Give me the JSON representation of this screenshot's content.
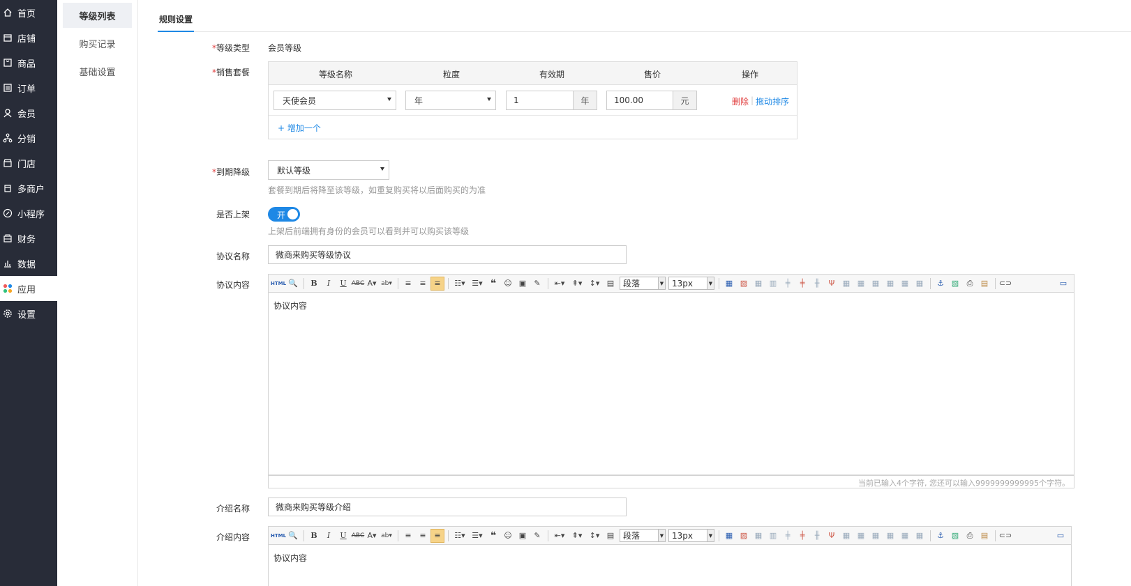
{
  "nav": {
    "items": [
      {
        "label": "首页",
        "icon": "home-icon"
      },
      {
        "label": "店铺",
        "icon": "store-icon"
      },
      {
        "label": "商品",
        "icon": "goods-icon"
      },
      {
        "label": "订单",
        "icon": "order-icon"
      },
      {
        "label": "会员",
        "icon": "user-icon"
      },
      {
        "label": "分销",
        "icon": "distribution-icon"
      },
      {
        "label": "门店",
        "icon": "shop-icon"
      },
      {
        "label": "多商户",
        "icon": "merchant-icon"
      },
      {
        "label": "小程序",
        "icon": "miniprogram-icon"
      },
      {
        "label": "财务",
        "icon": "finance-icon"
      },
      {
        "label": "数据",
        "icon": "chart-icon"
      },
      {
        "label": "应用",
        "icon": "apps-icon"
      },
      {
        "label": "设置",
        "icon": "gear-icon"
      }
    ],
    "active": "应用"
  },
  "subnav": {
    "items": [
      "等级列表",
      "购买记录",
      "基础设置"
    ],
    "active": "等级列表"
  },
  "tab": "规则设置",
  "form": {
    "level_type": {
      "label": "等级类型",
      "value": "会员等级"
    },
    "package": {
      "label": "销售套餐",
      "columns": [
        "等级名称",
        "粒度",
        "有效期",
        "售价",
        "操作"
      ],
      "rows": [
        {
          "level": "天使会员",
          "granularity": "年",
          "validity": "1",
          "validity_unit": "年",
          "price": "100.00",
          "price_unit": "元",
          "delete": "删除",
          "sort": "拖动排序"
        }
      ],
      "add": "+ 增加一个"
    },
    "expire": {
      "label": "到期降级",
      "value": "默认等级",
      "hint": "套餐到期后将降至该等级，如重复购买将以后面购买的为准"
    },
    "shelf": {
      "label": "是否上架",
      "toggle": "开",
      "hint": "上架后前端拥有身份的会员可以看到并可以购买该等级"
    },
    "agreement_name": {
      "label": "协议名称",
      "value": "微商来购买等级协议"
    },
    "agreement_content": {
      "label": "协议内容",
      "value": "协议内容",
      "counter": "当前已输入4个字符, 您还可以输入9999999999995个字符。"
    },
    "intro_name": {
      "label": "介绍名称",
      "value": "微商来购买等级介绍"
    },
    "intro_content": {
      "label": "介绍内容",
      "value": "协议内容"
    }
  },
  "toolbar": {
    "paragraph": "段落",
    "fontsize": "13px",
    "html_label": "HTML"
  }
}
